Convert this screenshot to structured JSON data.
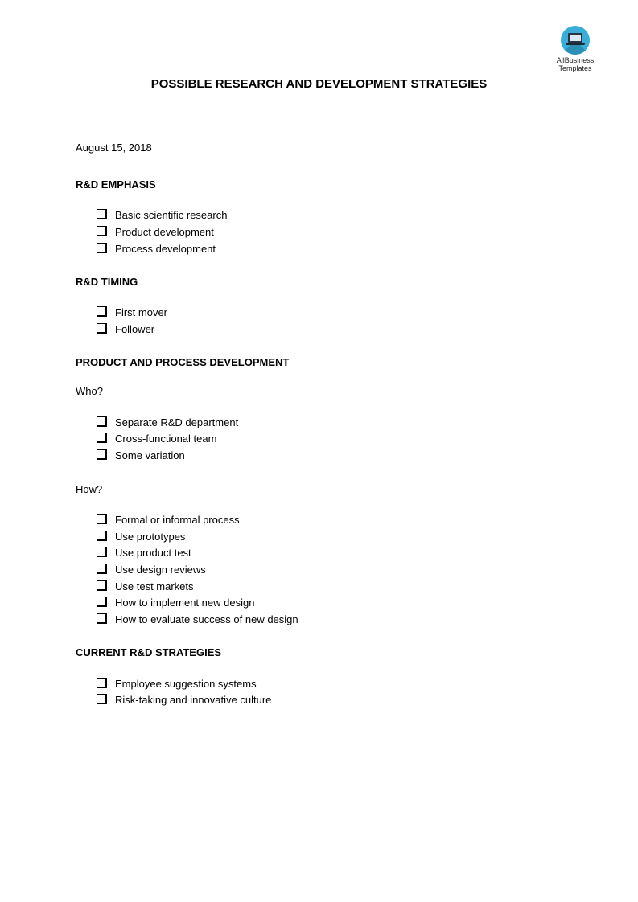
{
  "logo": {
    "icon": "laptop-icon",
    "line1": "AllBusiness",
    "line2": "Templates",
    "colors": {
      "circle": "#3aaed8",
      "laptop": "#263445"
    }
  },
  "title": "POSSIBLE RESEARCH AND DEVELOPMENT STRATEGIES",
  "date": "August 15, 2018",
  "sections": {
    "emphasis": {
      "heading": "R&D EMPHASIS",
      "items": [
        "Basic scientific research",
        "Product development",
        "Process development"
      ]
    },
    "timing": {
      "heading": "R&D TIMING",
      "items": [
        "First mover",
        "Follower"
      ]
    },
    "product_process": {
      "heading": "PRODUCT AND PROCESS DEVELOPMENT",
      "who": {
        "label": "Who?",
        "items": [
          "Separate R&D department",
          "Cross-functional team",
          "Some variation"
        ]
      },
      "how": {
        "label": "How?",
        "items": [
          "Formal or informal process",
          "Use prototypes",
          "Use product test",
          "Use design reviews",
          "Use test markets",
          "How to implement new design",
          "How to evaluate success of new design"
        ]
      }
    },
    "current": {
      "heading": "CURRENT R&D STRATEGIES",
      "items": [
        "Employee suggestion systems",
        "Risk-taking and innovative culture"
      ]
    }
  }
}
